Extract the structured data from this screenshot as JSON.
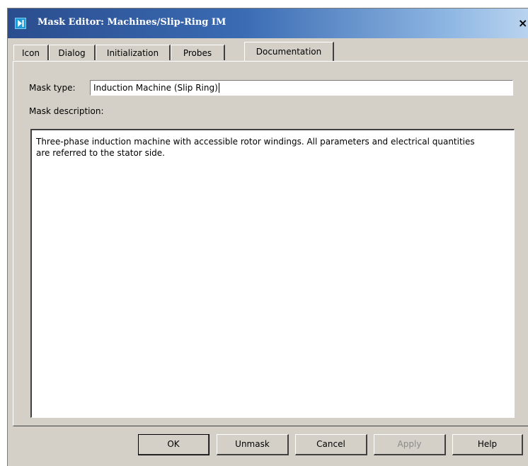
{
  "window": {
    "title": "Mask Editor: Machines/Slip-Ring IM",
    "close_glyph": "×"
  },
  "tabs": [
    {
      "label": "Icon",
      "active": false
    },
    {
      "label": "Dialog",
      "active": false
    },
    {
      "label": "Initialization",
      "active": false
    },
    {
      "label": "Probes",
      "active": false
    },
    {
      "label": "Documentation",
      "active": true
    }
  ],
  "documentation": {
    "mask_type_label": "Mask type:",
    "mask_type_value": "Induction Machine (Slip Ring)",
    "mask_description_label": "Mask description:",
    "mask_description_value": "Three-phase induction machine with accessible rotor windings. All parameters and electrical quantities\nare referred to the stator side."
  },
  "buttons": {
    "ok": "OK",
    "unmask": "Unmask",
    "cancel": "Cancel",
    "apply": "Apply",
    "help": "Help"
  },
  "colors": {
    "dialog_background": "#d4d0c8",
    "titlebar_start": "#2a4d8e",
    "titlebar_end": "#b9d3ef",
    "title_icon": "#1e9bd7"
  }
}
